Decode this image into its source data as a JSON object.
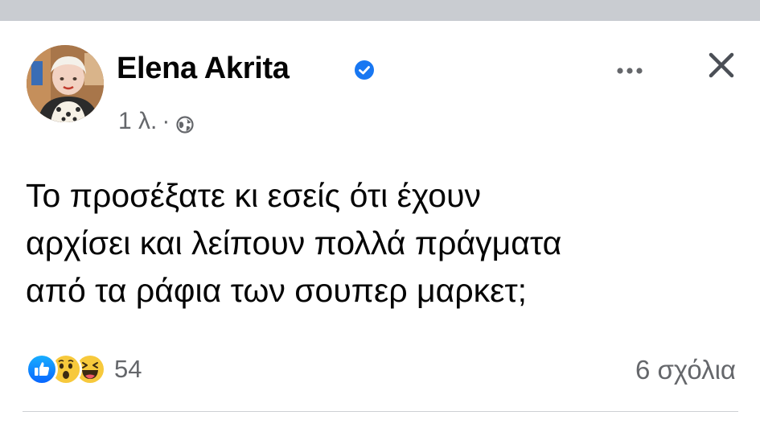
{
  "post": {
    "author": "Elena Akrita",
    "time": "1 λ.",
    "separator": "·",
    "text_lines": [
      "Το προσέξατε κι εσείς ότι έχουν",
      "αρχίσει και λείπουν πολλά πράγματα",
      "από τα ράφια των σουπερ μαρκετ;"
    ],
    "reactions": {
      "types": [
        "like-icon",
        "wow-icon",
        "haha-icon"
      ],
      "count": "54"
    },
    "comments_label": "6 σχόλια"
  },
  "colors": {
    "accent": "#1877f2",
    "secondary_text": "#65676b",
    "primary_text": "#050505",
    "topbar": "#c9ccd1"
  }
}
